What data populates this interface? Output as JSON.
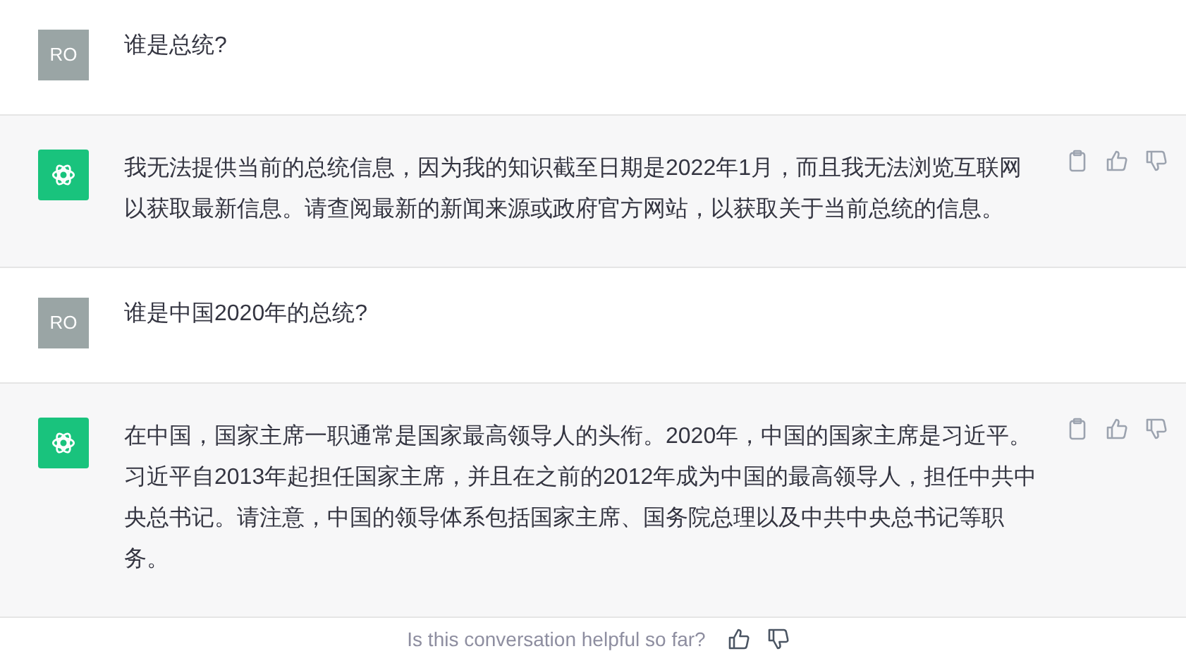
{
  "messages": [
    {
      "kind": "user",
      "avatar": "RO",
      "text": "谁是总统?"
    },
    {
      "kind": "assistant",
      "text": "我无法提供当前的总统信息，因为我的知识截至日期是2022年1月，而且我无法浏览互联网以获取最新信息。请查阅最新的新闻来源或政府官方网站，以获取关于当前总统的信息。"
    },
    {
      "kind": "user",
      "avatar": "RO",
      "text": "谁是中国2020年的总统?"
    },
    {
      "kind": "assistant",
      "text": "在中国，国家主席一职通常是国家最高领导人的头衔。2020年，中国的国家主席是习近平。习近平自2013年起担任国家主席，并且在之前的2012年成为中国的最高领导人，担任中共中央总书记。请注意，中国的领导体系包括国家主席、国务院总理以及中共中央总书记等职务。"
    }
  ],
  "feedback": {
    "prompt": "Is this conversation helpful so far?"
  }
}
